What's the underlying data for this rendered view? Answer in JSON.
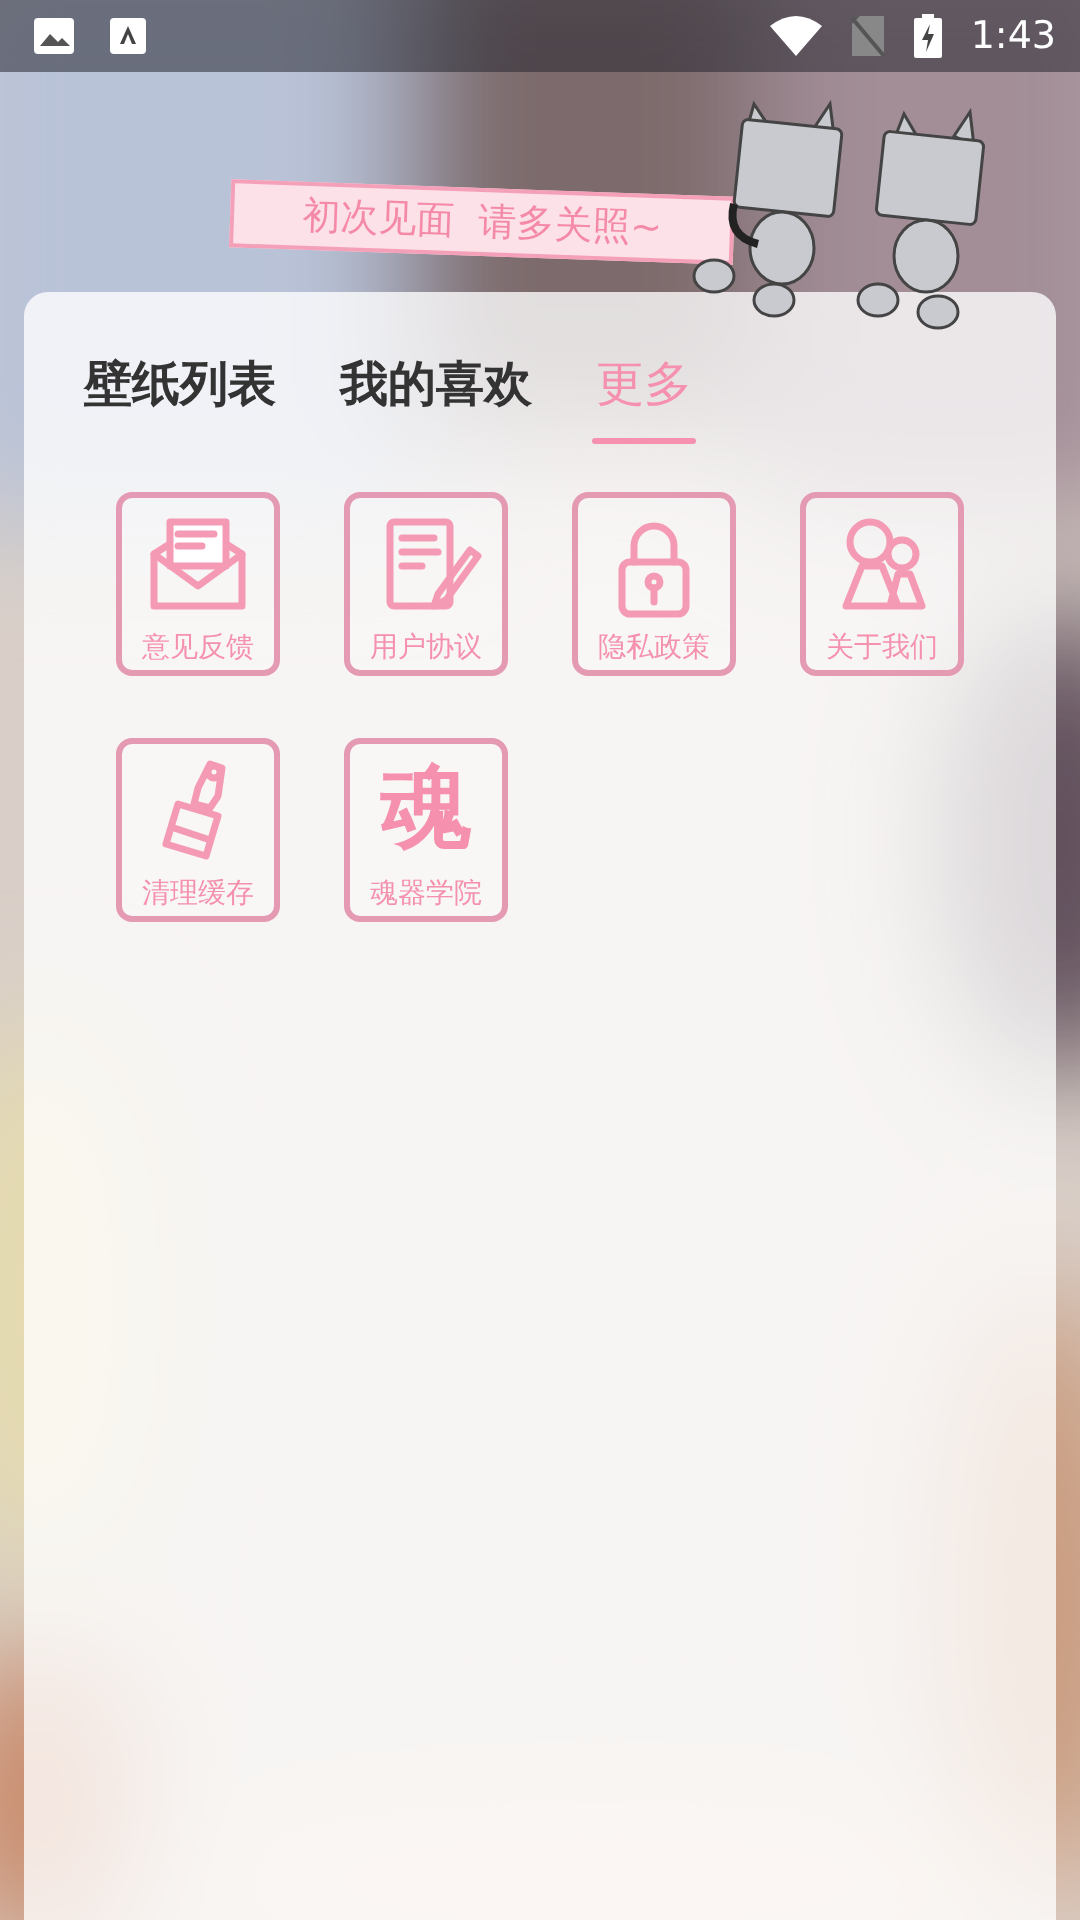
{
  "status_bar": {
    "time": "1:43"
  },
  "banner": {
    "text": "初次见面  请多关照~"
  },
  "tabs": [
    {
      "label": "壁纸列表",
      "selected": false
    },
    {
      "label": "我的喜欢",
      "selected": false
    },
    {
      "label": "更多",
      "selected": true
    }
  ],
  "menu": [
    {
      "label": "意见反馈",
      "kind": "envelope"
    },
    {
      "label": "用户协议",
      "kind": "document"
    },
    {
      "label": "隐私政策",
      "kind": "lock"
    },
    {
      "label": "关于我们",
      "kind": "people"
    },
    {
      "label": "清理缓存",
      "kind": "brush"
    },
    {
      "label": "魂器学院",
      "kind": "glyph",
      "glyph": "魂"
    }
  ]
}
